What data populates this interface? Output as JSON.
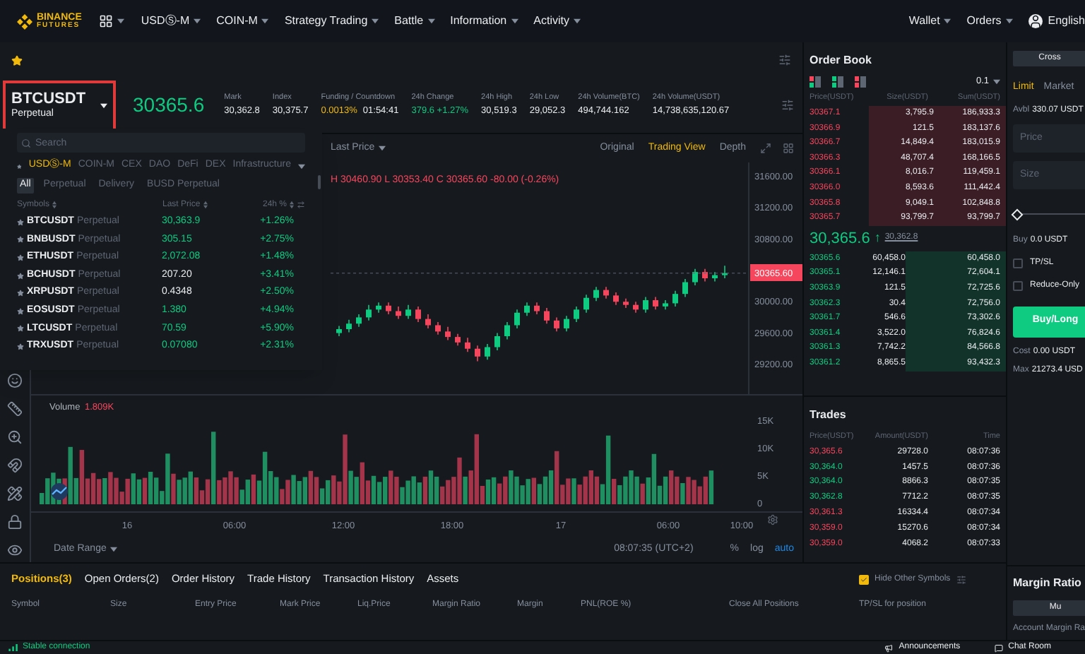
{
  "nav": {
    "logo_top": "BINANCE",
    "logo_bottom": "FUTURES",
    "menu": [
      "USDⓈ-M",
      "COIN-M",
      "Strategy Trading",
      "Battle",
      "Information",
      "Activity"
    ],
    "right": [
      "Wallet",
      "Orders"
    ],
    "language": "English"
  },
  "ticker": {
    "symbol": "BTCUSDT",
    "contract": "Perpetual",
    "last_price": "30365.6",
    "stats": [
      {
        "label": "Mark",
        "parts": [
          {
            "text": "30,362.8",
            "color": "#eaecef"
          }
        ]
      },
      {
        "label": "Index",
        "parts": [
          {
            "text": "30,375.7",
            "color": "#eaecef"
          }
        ]
      },
      {
        "label": "Funding / Countdown",
        "parts": [
          {
            "text": "0.0013%",
            "color": "#f0b90b"
          },
          {
            "text": "01:54:41",
            "color": "#eaecef"
          }
        ]
      },
      {
        "label": "24h Change",
        "parts": [
          {
            "text": "379.6 +1.27%",
            "color": "#0ecb81"
          }
        ]
      },
      {
        "label": "24h High",
        "parts": [
          {
            "text": "30,519.3",
            "color": "#eaecef"
          }
        ]
      },
      {
        "label": "24h Low",
        "parts": [
          {
            "text": "29,052.3",
            "color": "#eaecef"
          }
        ]
      },
      {
        "label": "24h Volume(BTC)",
        "parts": [
          {
            "text": "494,744.162",
            "color": "#eaecef"
          }
        ]
      },
      {
        "label": "24h Volume(USDT)",
        "parts": [
          {
            "text": "14,738,635,120.67",
            "color": "#eaecef"
          }
        ]
      }
    ]
  },
  "symbol_dropdown": {
    "search_placeholder": "Search",
    "categories": [
      {
        "label": "USDⓈ-M",
        "selected": true
      },
      {
        "label": "COIN-M",
        "selected": false
      },
      {
        "label": "CEX",
        "selected": false
      },
      {
        "label": "DAO",
        "selected": false
      },
      {
        "label": "DeFi",
        "selected": false
      },
      {
        "label": "DEX",
        "selected": false
      },
      {
        "label": "Infrastructure",
        "selected": false
      }
    ],
    "filters": [
      {
        "label": "All",
        "selected": true
      },
      {
        "label": "Perpetual",
        "selected": false
      },
      {
        "label": "Delivery",
        "selected": false
      },
      {
        "label": "BUSD Perpetual",
        "selected": false
      }
    ],
    "columns": [
      "Symbols",
      "Last Price",
      "24h %"
    ],
    "rows": [
      {
        "symbol": "BTCUSDT",
        "contract": "Perpetual",
        "price": "30,363.9",
        "color": "#0ecb81",
        "change": "+1.26%"
      },
      {
        "symbol": "BNBUSDT",
        "contract": "Perpetual",
        "price": "305.15",
        "color": "#0ecb81",
        "change": "+2.75%"
      },
      {
        "symbol": "ETHUSDT",
        "contract": "Perpetual",
        "price": "2,072.08",
        "color": "#0ecb81",
        "change": "+1.48%"
      },
      {
        "symbol": "BCHUSDT",
        "contract": "Perpetual",
        "price": "207.20",
        "color": "#eaecef",
        "change": "+3.41%"
      },
      {
        "symbol": "XRPUSDT",
        "contract": "Perpetual",
        "price": "0.4348",
        "color": "#eaecef",
        "change": "+2.50%"
      },
      {
        "symbol": "EOSUSDT",
        "contract": "Perpetual",
        "price": "1.380",
        "color": "#0ecb81",
        "change": "+4.94%"
      },
      {
        "symbol": "LTCUSDT",
        "contract": "Perpetual",
        "price": "70.59",
        "color": "#0ecb81",
        "change": "+5.90%"
      },
      {
        "symbol": "TRXUSDT",
        "contract": "Perpetual",
        "price": "0.07080",
        "color": "#0ecb81",
        "change": "+2.31%"
      }
    ]
  },
  "chart": {
    "price_type": "Last Price",
    "views": [
      {
        "label": "Original",
        "selected": false
      },
      {
        "label": "Trading View",
        "selected": true
      },
      {
        "label": "Depth",
        "selected": false
      }
    ],
    "ohlc": "H 30460.90  L 30353.40  C 30365.60  -80.00 (-0.26%)",
    "chart_data": {
      "type": "candlestick",
      "ylim": [
        28820,
        31780
      ],
      "yticks": [
        {
          "value": 31600,
          "label": "31600.00"
        },
        {
          "value": 31200,
          "label": "31200.00"
        },
        {
          "value": 30800,
          "label": "30800.00"
        },
        {
          "value": 30000,
          "label": "30000.00"
        },
        {
          "value": 29600,
          "label": "29600.00"
        },
        {
          "value": 29200,
          "label": "29200.00"
        }
      ],
      "ohlc": [
        [
          29600,
          29690,
          29560,
          29650
        ],
        [
          29650,
          29770,
          29610,
          29720
        ],
        [
          29720,
          29840,
          29680,
          29800
        ],
        [
          29800,
          29960,
          29760,
          29900
        ],
        [
          29900,
          29990,
          29860,
          29950
        ],
        [
          29950,
          29990,
          29840,
          29880
        ],
        [
          29880,
          29940,
          29780,
          29820
        ],
        [
          29820,
          29960,
          29780,
          29900
        ],
        [
          29900,
          29940,
          29740,
          29780
        ],
        [
          29780,
          29840,
          29660,
          29700
        ],
        [
          29700,
          29740,
          29580,
          29620
        ],
        [
          29620,
          29680,
          29510,
          29550
        ],
        [
          29550,
          29590,
          29440,
          29480
        ],
        [
          29480,
          29540,
          29360,
          29400
        ],
        [
          29400,
          29440,
          29240,
          29300
        ],
        [
          29300,
          29460,
          29260,
          29420
        ],
        [
          29420,
          29600,
          29380,
          29560
        ],
        [
          29560,
          29740,
          29520,
          29700
        ],
        [
          29700,
          29900,
          29660,
          29860
        ],
        [
          29860,
          29990,
          29820,
          29950
        ],
        [
          29950,
          29990,
          29840,
          29880
        ],
        [
          29880,
          29920,
          29720,
          29760
        ],
        [
          29760,
          29800,
          29620,
          29660
        ],
        [
          29660,
          29820,
          29620,
          29780
        ],
        [
          29780,
          29940,
          29740,
          29900
        ],
        [
          29900,
          30090,
          29860,
          30050
        ],
        [
          30050,
          30190,
          30010,
          30150
        ],
        [
          30150,
          30190,
          30040,
          30080
        ],
        [
          30080,
          30120,
          29960,
          30000
        ],
        [
          30000,
          30040,
          29920,
          29960
        ],
        [
          29960,
          30000,
          29860,
          29900
        ],
        [
          29900,
          30060,
          29860,
          30020
        ],
        [
          30020,
          30060,
          29900,
          29940
        ],
        [
          29940,
          30020,
          29900,
          29980
        ],
        [
          29980,
          30140,
          29940,
          30100
        ],
        [
          30100,
          30290,
          30060,
          30250
        ],
        [
          30250,
          30420,
          30210,
          30380
        ],
        [
          30380,
          30420,
          30260,
          30300
        ],
        [
          30300,
          30380,
          30260,
          30340
        ],
        [
          30340,
          30460,
          30300,
          30365
        ]
      ]
    },
    "last_price_tag": "30365.60",
    "volume_label": "Volume",
    "volume_value": "1.809K",
    "volume_ticks": [
      "15K",
      "10K",
      "5K",
      "0"
    ],
    "time_ticks": [
      "16",
      "06:00",
      "12:00",
      "18:00",
      "17",
      "06:00",
      "10:00"
    ],
    "date_range": "Date Range",
    "clock": "08:07:35 (UTC+2)",
    "scale_options": [
      {
        "label": "%",
        "selected": false
      },
      {
        "label": "log",
        "selected": false
      },
      {
        "label": "auto",
        "selected": true
      }
    ]
  },
  "order_book": {
    "title": "Order Book",
    "precision": "0.1",
    "columns": [
      "Price(USDT)",
      "Size(USDT)",
      "Sum(USDT)"
    ],
    "asks": [
      {
        "price": "30367.1",
        "size": "3,795.9",
        "sum": "186,933.3"
      },
      {
        "price": "30366.9",
        "size": "121.5",
        "sum": "183,137.6"
      },
      {
        "price": "30366.7",
        "size": "14,849.4",
        "sum": "183,015.9"
      },
      {
        "price": "30366.3",
        "size": "48,707.4",
        "sum": "168,166.5"
      },
      {
        "price": "30366.1",
        "size": "8,016.7",
        "sum": "119,459.1"
      },
      {
        "price": "30366.0",
        "size": "8,593.6",
        "sum": "111,442.4"
      },
      {
        "price": "30365.8",
        "size": "9,049.1",
        "sum": "102,848.8"
      },
      {
        "price": "30365.7",
        "size": "93,799.7",
        "sum": "93,799.7"
      }
    ],
    "mid_price": "30,365.6",
    "mid_arrow": "↑",
    "mark_price": "30,362.8",
    "bids": [
      {
        "price": "30365.6",
        "size": "60,458.0",
        "sum": "60,458.0"
      },
      {
        "price": "30365.1",
        "size": "12,146.1",
        "sum": "72,604.1"
      },
      {
        "price": "30363.9",
        "size": "121.5",
        "sum": "72,725.6"
      },
      {
        "price": "30362.3",
        "size": "30.4",
        "sum": "72,756.0"
      },
      {
        "price": "30361.7",
        "size": "546.6",
        "sum": "73,302.6"
      },
      {
        "price": "30361.4",
        "size": "3,522.0",
        "sum": "76,824.6"
      },
      {
        "price": "30361.3",
        "size": "7,742.2",
        "sum": "84,566.8"
      },
      {
        "price": "30361.2",
        "size": "8,865.5",
        "sum": "93,432.3"
      }
    ]
  },
  "trades": {
    "title": "Trades",
    "columns": [
      "Price(USDT)",
      "Amount(USDT)",
      "Time"
    ],
    "rows": [
      {
        "price": "30,365.6",
        "amount": "29728.0",
        "time": "08:07:36",
        "color": "#f6465d"
      },
      {
        "price": "30,364.0",
        "amount": "1457.5",
        "time": "08:07:36",
        "color": "#0ecb81"
      },
      {
        "price": "30,364.0",
        "amount": "8866.3",
        "time": "08:07:35",
        "color": "#0ecb81"
      },
      {
        "price": "30,362.8",
        "amount": "7712.2",
        "time": "08:07:35",
        "color": "#0ecb81"
      },
      {
        "price": "30,361.3",
        "amount": "16334.4",
        "time": "08:07:34",
        "color": "#f6465d"
      },
      {
        "price": "30,359.0",
        "amount": "15270.6",
        "time": "08:07:34",
        "color": "#f6465d"
      },
      {
        "price": "30,359.0",
        "amount": "4068.2",
        "time": "08:07:33",
        "color": "#f6465d"
      }
    ]
  },
  "trade_panel": {
    "margin_mode": "Cross",
    "order_types": [
      {
        "label": "Limit",
        "selected": true
      },
      {
        "label": "Market",
        "selected": false
      }
    ],
    "avbl_label": "Avbl",
    "avbl_value": "330.07 USDT",
    "price_placeholder": "Price",
    "size_placeholder": "Size",
    "slider": {
      "level": 0
    },
    "buy_label": "Buy",
    "buy_value": "0.0 USDT",
    "options": [
      {
        "label": "TP/SL",
        "checked": false
      },
      {
        "label": "Reduce-Only",
        "checked": false
      }
    ],
    "submit": "Buy/Long",
    "cost_label": "Cost",
    "cost_value": "0.00 USDT",
    "max_label": "Max",
    "max_value": "21273.4 USD"
  },
  "margin_ratio": {
    "title": "Margin Ratio",
    "mode_button": "Mu",
    "account_label": "Account Margin Ra"
  },
  "positions": {
    "tabs": [
      {
        "label": "Positions(3)",
        "selected": true
      },
      {
        "label": "Open Orders(2)",
        "selected": false
      },
      {
        "label": "Order History",
        "selected": false
      },
      {
        "label": "Trade History",
        "selected": false
      },
      {
        "label": "Transaction History",
        "selected": false
      },
      {
        "label": "Assets",
        "selected": false
      }
    ],
    "columns": [
      "Symbol",
      "Size",
      "Entry Price",
      "Mark Price",
      "Liq.Price",
      "Margin Ratio",
      "Margin",
      "PNL(ROE %)"
    ],
    "close_all": "Close All Positions",
    "hide_other": {
      "label": "Hide Other Symbols",
      "checked": true
    },
    "tpsl_header": "TP/SL for position"
  },
  "status_bar": {
    "connection": "Stable connection",
    "links": [
      "Announcements",
      "Chat Room"
    ]
  }
}
